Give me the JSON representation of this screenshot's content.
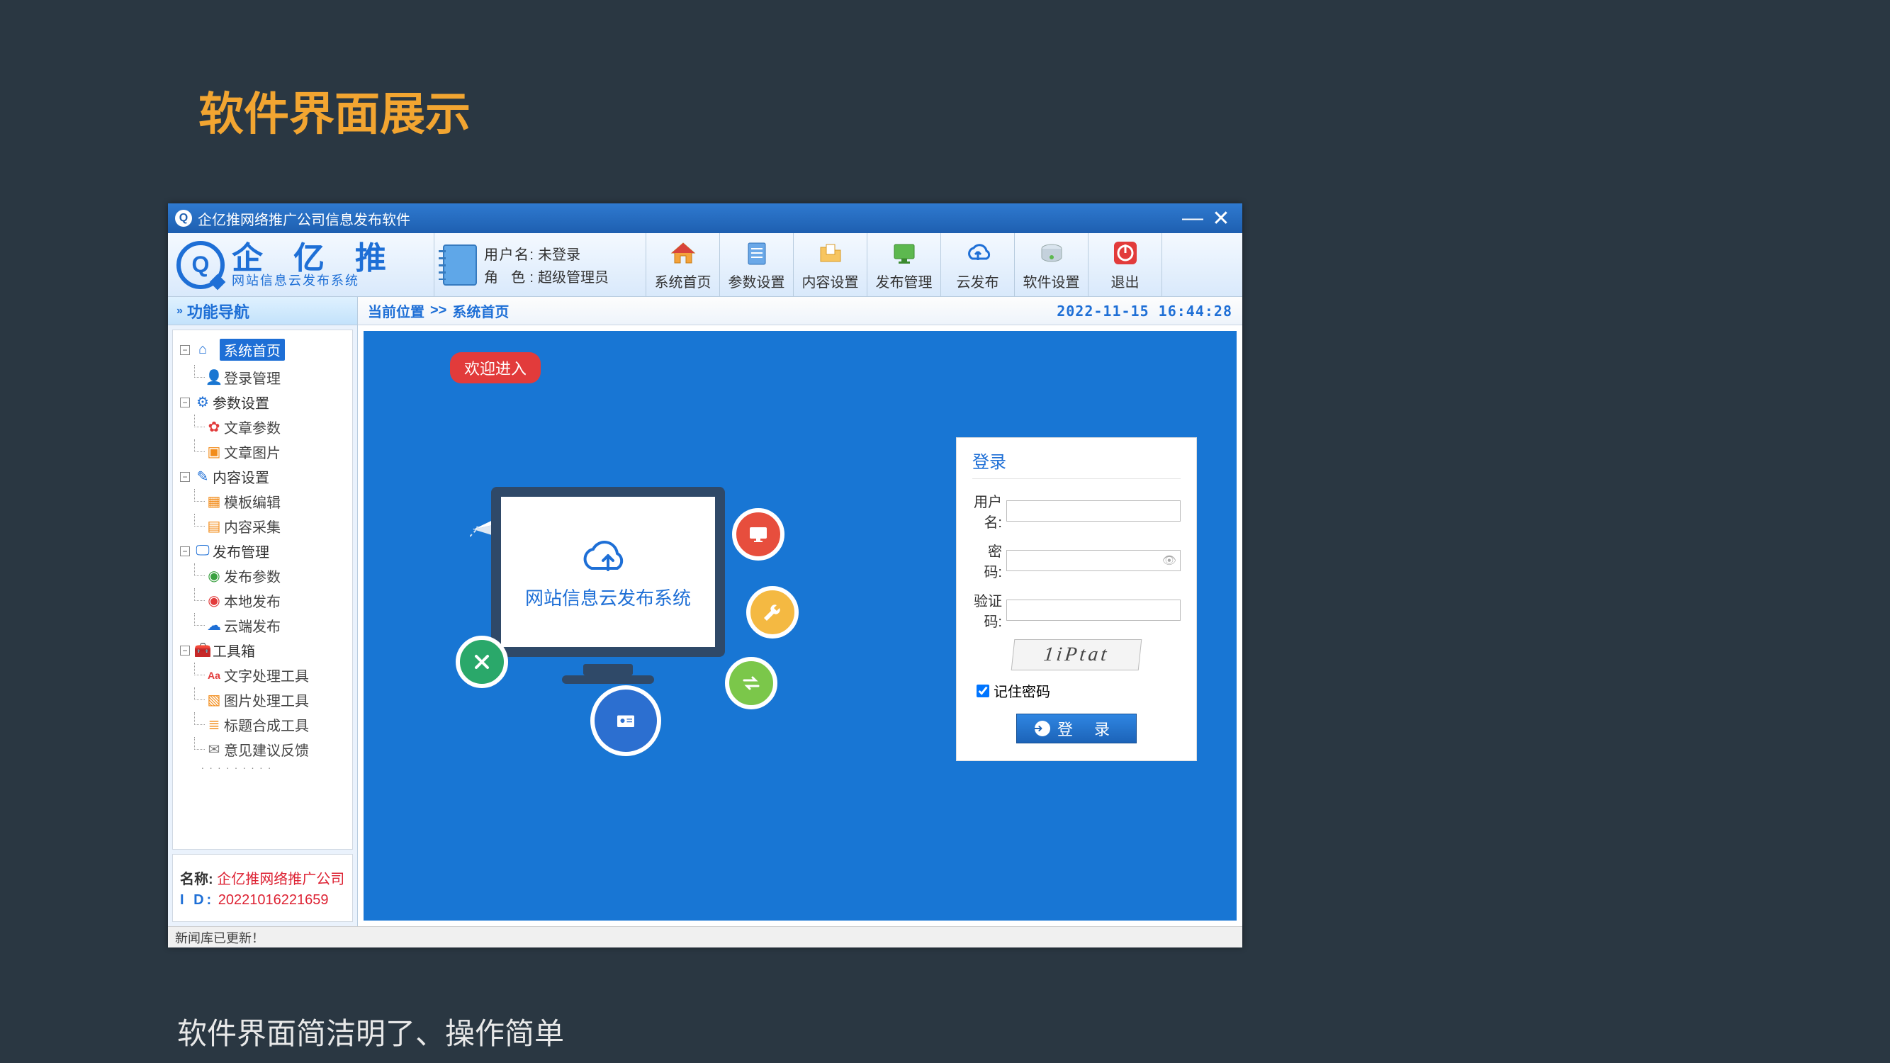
{
  "slide": {
    "title": "软件界面展示",
    "caption": "软件界面简洁明了、操作简单"
  },
  "titlebar": {
    "app_title": "企亿推网络推广公司信息发布软件"
  },
  "logo": {
    "name": "企 亿 推",
    "sub": "网站信息云发布系统",
    "mark_letter": "Q"
  },
  "userinfo": {
    "user_label": "用户名:",
    "user_value": "未登录",
    "role_label": "角  色:",
    "role_value": "超级管理员"
  },
  "toolbar": [
    {
      "id": "home",
      "label": "系统首页"
    },
    {
      "id": "params",
      "label": "参数设置"
    },
    {
      "id": "content",
      "label": "内容设置"
    },
    {
      "id": "publish",
      "label": "发布管理"
    },
    {
      "id": "cloud",
      "label": "云发布"
    },
    {
      "id": "soft",
      "label": "软件设置"
    },
    {
      "id": "exit",
      "label": "退出"
    }
  ],
  "sidebar": {
    "header": "功能导航",
    "groups": [
      {
        "id": "home",
        "label": "系统首页",
        "active": true,
        "children": [
          {
            "id": "login-mgmt",
            "label": "登录管理"
          }
        ]
      },
      {
        "id": "params",
        "label": "参数设置",
        "children": [
          {
            "id": "art-params",
            "label": "文章参数"
          },
          {
            "id": "art-images",
            "label": "文章图片"
          }
        ]
      },
      {
        "id": "content",
        "label": "内容设置",
        "children": [
          {
            "id": "tpl-edit",
            "label": "模板编辑"
          },
          {
            "id": "collect",
            "label": "内容采集"
          }
        ]
      },
      {
        "id": "publish",
        "label": "发布管理",
        "children": [
          {
            "id": "pub-params",
            "label": "发布参数"
          },
          {
            "id": "local-pub",
            "label": "本地发布"
          },
          {
            "id": "cloud-pub",
            "label": "云端发布"
          }
        ]
      },
      {
        "id": "tools",
        "label": "工具箱",
        "children": [
          {
            "id": "text-tool",
            "label": "文字处理工具"
          },
          {
            "id": "img-tool",
            "label": "图片处理工具"
          },
          {
            "id": "title-tool",
            "label": "标题合成工具"
          },
          {
            "id": "feedback",
            "label": "意见建议反馈"
          }
        ]
      }
    ],
    "footer": {
      "name_label": "名称:",
      "name_value": "企亿推网络推广公司",
      "id_label": "I  D:",
      "id_value": "20221016221659"
    }
  },
  "breadcrumb": {
    "location_label": "当前位置",
    "separator": ">>",
    "page": "系统首页",
    "timestamp": "2022-11-15 16:44:28"
  },
  "welcome": "欢迎进入",
  "illustration": {
    "monitor_text": "网站信息云发布系统"
  },
  "login": {
    "title": "登录",
    "user_label": "用户名:",
    "password_label": "密  码:",
    "captcha_label": "验证码:",
    "captcha_text": "1iPtat",
    "remember_label": "记住密码",
    "remember_checked": true,
    "submit_label": "登 录"
  },
  "statusbar": {
    "text": "新闻库已更新！"
  }
}
